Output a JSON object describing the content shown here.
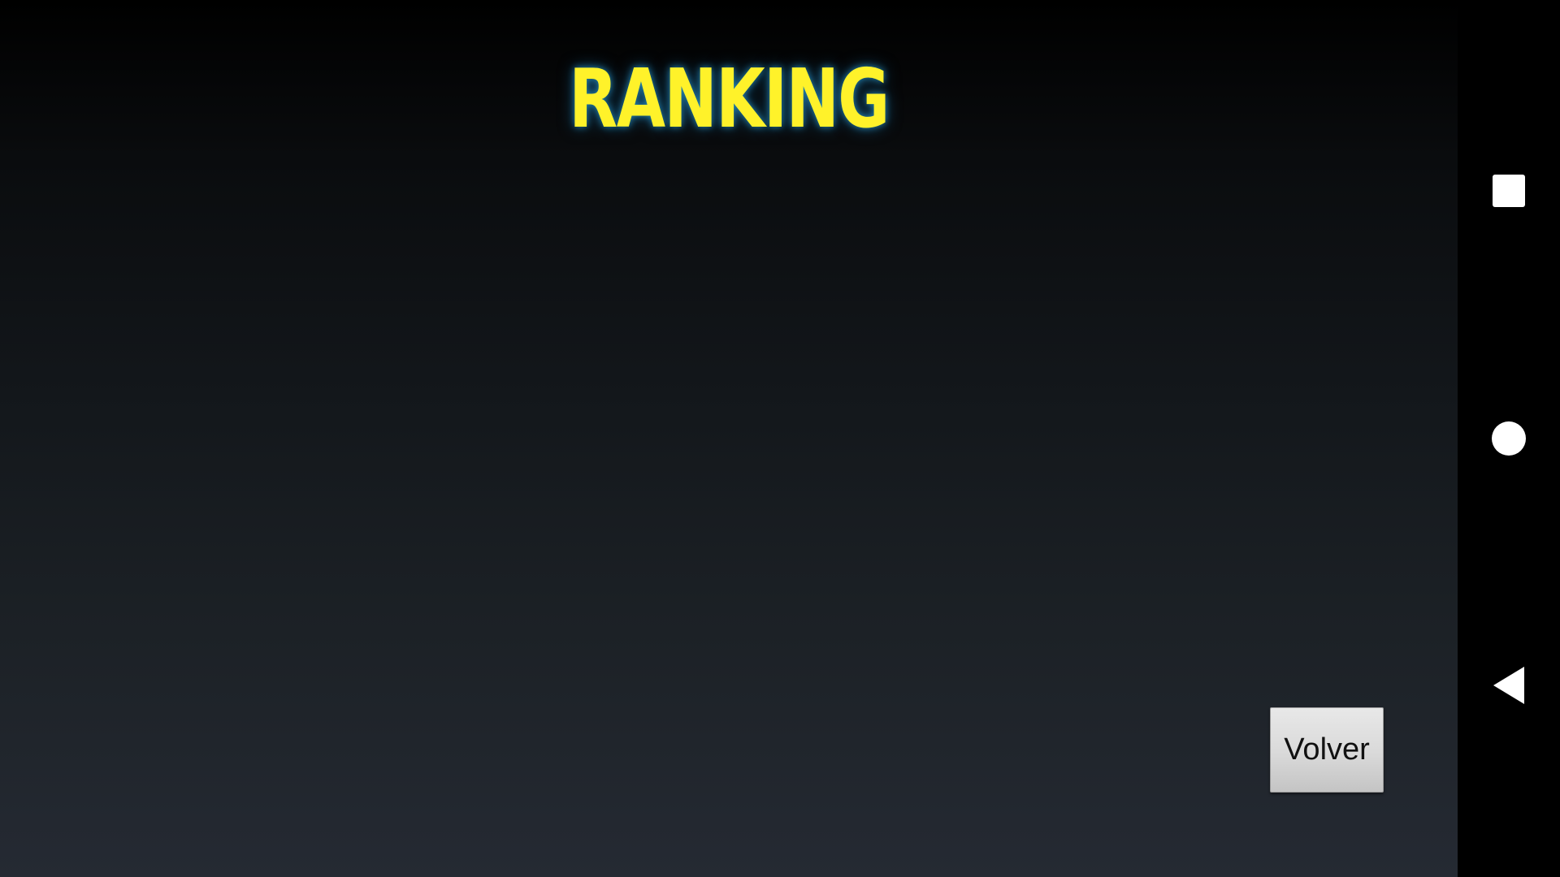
{
  "screen": {
    "title": "RANKING",
    "back_button_label": "Volver"
  },
  "navbar": {
    "recents_icon": "square-icon",
    "home_icon": "circle-icon",
    "back_icon": "triangle-back-icon"
  },
  "colors": {
    "title": "#fff22a",
    "title_glow": "#2896c8",
    "background_top": "#000000",
    "background_bottom": "#252a33",
    "button_face": "#d9d9d9",
    "navbar": "#000000"
  }
}
